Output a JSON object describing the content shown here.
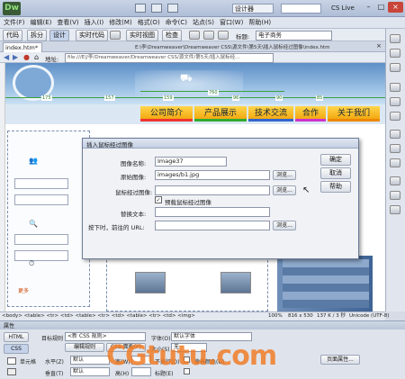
{
  "titlebar": {
    "logo": "Dw",
    "designer_label": "设计器",
    "cslive": "CS Live"
  },
  "menubar": [
    "文件(F)",
    "编辑(E)",
    "查看(V)",
    "插入(I)",
    "修改(M)",
    "格式(O)",
    "命令(C)",
    "站点(S)",
    "窗口(W)",
    "帮助(H)"
  ],
  "doc_toolbar": {
    "code": "代码",
    "split": "拆分",
    "design": "设计",
    "live_code": "实时代码",
    "live_view": "实时视图",
    "inspect": "检查",
    "title_label": "标题:",
    "title_value": "电子商务"
  },
  "tab": {
    "name": "index.htm*",
    "path": "E:\\李\\Dreamweaver\\Dreamweaver CSS\\源文件\\第5天\\插入鼠标经过图像\\index.htm"
  },
  "address": {
    "label": "地址:",
    "value": "file:///E|/李/Dreamweaver/Dreamweaver CSS/源文件/第5天/插入鼠标经..."
  },
  "rulers": {
    "widths": [
      "175",
      "157",
      "159",
      "96",
      "90",
      "85"
    ],
    "total": "760"
  },
  "nav": [
    "公司简介",
    "产品展示",
    "技术交流",
    "合作",
    "关于我们"
  ],
  "side_text": "更多",
  "dialog": {
    "title": "插入鼠标经过图像",
    "name_label": "图像名称:",
    "name_value": "Image37",
    "original_label": "原始图像:",
    "original_value": "images/b1.jpg",
    "rollover_label": "鼠标经过图像:",
    "rollover_value": "",
    "preload_label": "预载鼠标经过图像",
    "alt_label": "替换文本:",
    "alt_value": "",
    "link_label": "按下时，前往的 URL:",
    "link_value": "",
    "browse": "浏览...",
    "ok": "确定",
    "cancel": "取消",
    "help": "帮助"
  },
  "statusbar": {
    "tags": "<body> <table> <tr> <td> <table> <tr> <td> <table> <tr> <td> <img>",
    "zoom": "100%",
    "size": "816 x 530",
    "weight": "137 K / 3 秒",
    "encoding": "Unicode (UTF-8)"
  },
  "properties": {
    "header": "属性",
    "html_btn": "HTML",
    "css_btn": "CSS",
    "target_rule_label": "目标规则",
    "target_rule_value": "<新 CSS 规则>",
    "font_label": "字体(O)",
    "font_value": "默认字体",
    "edit_rule": "编辑规则",
    "css_panel": "CSS 面板(P)",
    "size_label": "大小(S)",
    "size_value": "无",
    "cell_label": "单元格",
    "horz_label": "水平(Z)",
    "horz_value": "默认",
    "wide_label": "宽(W)",
    "nowrap_label": "不换行(O)",
    "bg_label": "背景颜色(G)",
    "page_props": "页面属性...",
    "vert_label": "垂直(T)",
    "vert_value": "默认",
    "high_label": "高(H)",
    "header_label": "标题(E)"
  },
  "watermark": "CGtutu.com"
}
